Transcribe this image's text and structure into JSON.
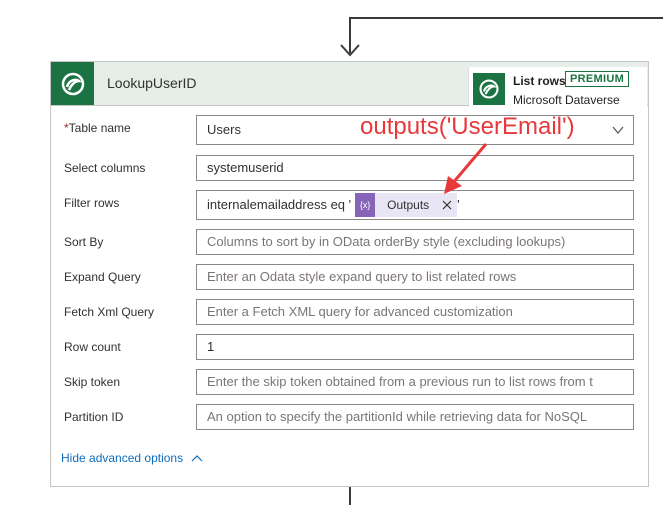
{
  "card": {
    "title": "LookupUserID",
    "action_name": "List rows",
    "premium_badge": "PREMIUM",
    "connector_name": "Microsoft Dataverse",
    "logo_icon": "dataverse-icon",
    "brand_color": "#1b7343"
  },
  "fields": {
    "table_name": {
      "required_mark": "*",
      "label": "Table name",
      "value": "Users"
    },
    "select_columns": {
      "label": "Select columns",
      "value": "systemuserid"
    },
    "filter_rows": {
      "label": "Filter rows",
      "value_prefix": "internalemailaddress eq '",
      "token_icon": "{x}",
      "token_label": "Outputs",
      "value_suffix": "'"
    },
    "sort_by": {
      "label": "Sort By",
      "placeholder": "Columns to sort by in OData orderBy style (excluding lookups)"
    },
    "expand_query": {
      "label": "Expand Query",
      "placeholder": "Enter an Odata style expand query to list related rows"
    },
    "fetch_xml": {
      "label": "Fetch Xml Query",
      "placeholder": "Enter a Fetch XML query for advanced customization"
    },
    "row_count": {
      "label": "Row count",
      "value": "1"
    },
    "skip_token": {
      "label": "Skip token",
      "placeholder": "Enter the skip token obtained from a previous run to list rows from t"
    },
    "partition_id": {
      "label": "Partition ID",
      "placeholder": "An option to specify the partitionId while retrieving data for NoSQL"
    }
  },
  "hide_advanced": "Hide advanced options",
  "annotation": {
    "text": "outputs('UserEmail')",
    "color": "#e8383a"
  }
}
